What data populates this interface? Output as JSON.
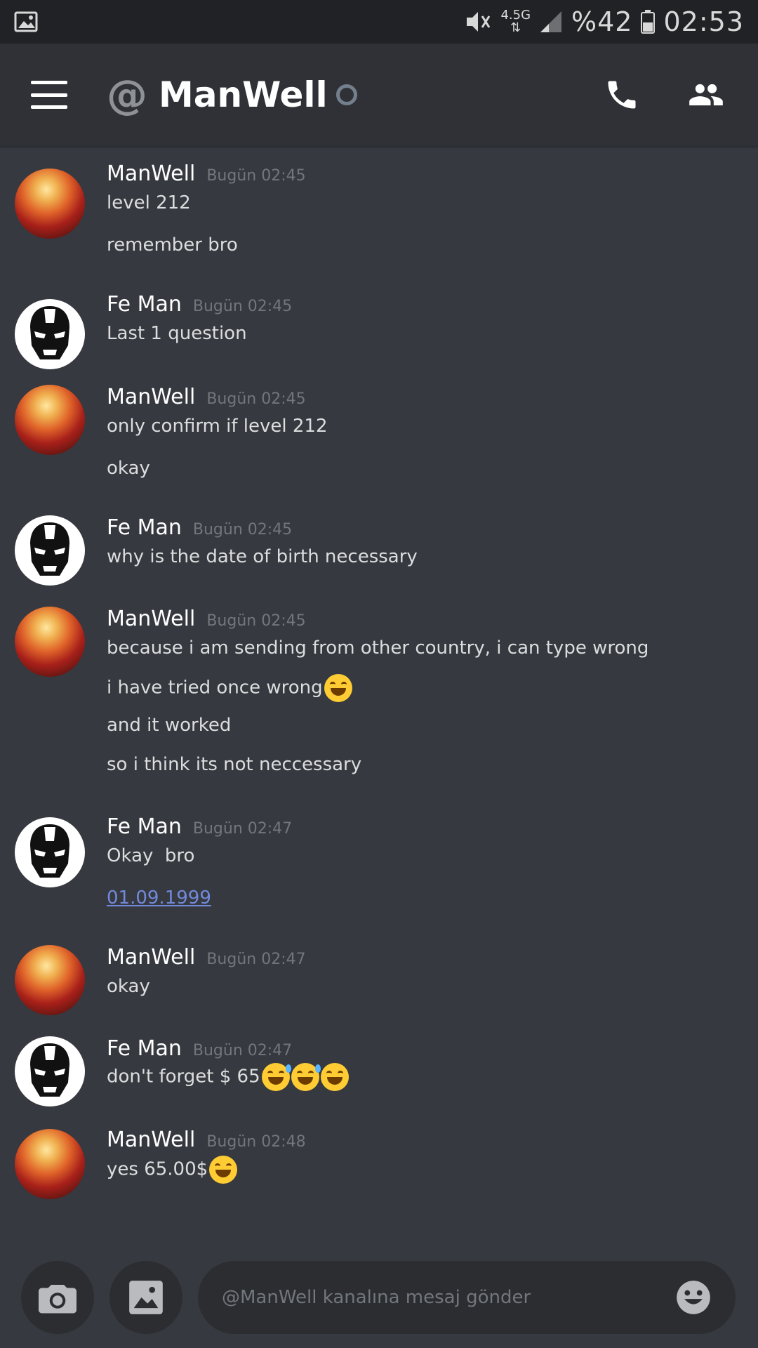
{
  "status_bar": {
    "network_type": "4.5G",
    "battery_percent": "%42",
    "time": "02:53"
  },
  "header": {
    "channel_name": "ManWell"
  },
  "messages": [
    {
      "author": "ManWell",
      "timestamp": "Bugün 02:45",
      "avatar": "manwell-avatar",
      "lines": [
        "level 212",
        "remember bro"
      ]
    },
    {
      "author": "Fe Man",
      "timestamp": "Bugün 02:45",
      "avatar": "ironman-avatar",
      "lines": [
        "Last 1 question"
      ]
    },
    {
      "author": "ManWell",
      "timestamp": "Bugün 02:45",
      "avatar": "manwell-avatar",
      "lines": [
        "only confirm if level 212",
        "okay"
      ]
    },
    {
      "author": "Fe Man",
      "timestamp": "Bugün 02:45",
      "avatar": "ironman-avatar",
      "lines": [
        "why is the date of birth necessary"
      ]
    },
    {
      "author": "ManWell",
      "timestamp": "Bugün 02:45",
      "avatar": "manwell-avatar",
      "lines": [
        "because i am sending from other country, i can type wrong",
        "i have tried once wrong",
        "and it worked",
        "so i think its not neccessary"
      ]
    },
    {
      "author": "Fe Man",
      "timestamp": "Bugün 02:47",
      "avatar": "ironman-avatar",
      "lines": [
        "Okay  bro",
        "01.09.1999"
      ]
    },
    {
      "author": "ManWell",
      "timestamp": "Bugün 02:47",
      "avatar": "manwell-avatar",
      "lines": [
        "okay"
      ]
    },
    {
      "author": "Fe Man",
      "timestamp": "Bugün 02:47",
      "avatar": "ironman-avatar",
      "lines": [
        "don't forget $ 65"
      ]
    },
    {
      "author": "ManWell",
      "timestamp": "Bugün 02:48",
      "avatar": "manwell-avatar",
      "lines": [
        "yes 65.00$"
      ]
    }
  ],
  "composer": {
    "placeholder": "@ManWell kanalına mesaj gönder"
  }
}
